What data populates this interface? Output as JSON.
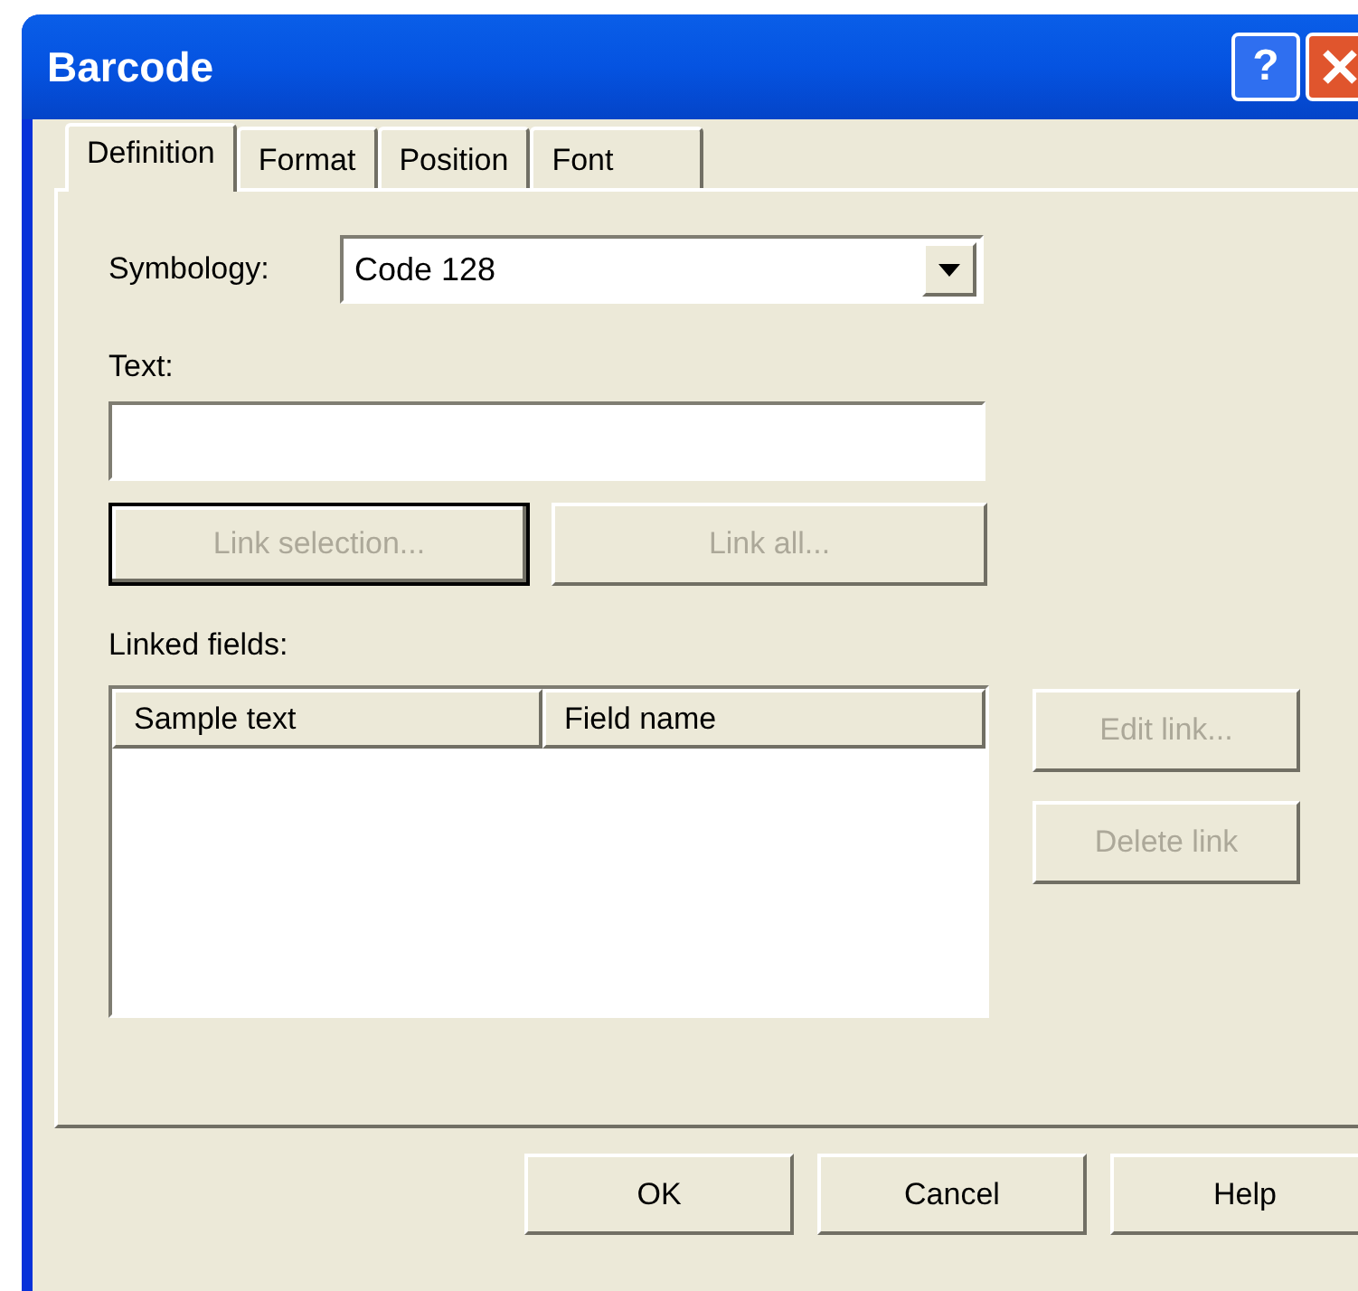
{
  "window": {
    "title": "Barcode"
  },
  "title_buttons": [
    {
      "kind": "help",
      "label": "?"
    },
    {
      "kind": "close"
    }
  ],
  "tabs": [
    {
      "label": "Definition",
      "selected": true
    },
    {
      "label": "Format",
      "selected": false
    },
    {
      "label": "Position",
      "selected": false
    },
    {
      "label": "Font",
      "selected": false
    }
  ],
  "symbology": {
    "label": "Symbology:",
    "value": "Code 128"
  },
  "text_field": {
    "label": "Text:"
  },
  "link_buttons": [
    {
      "label": "Link selection...",
      "disabled": true,
      "default": true
    },
    {
      "label": "Link all...",
      "disabled": true,
      "default": false
    }
  ],
  "linked_fields": {
    "label": "Linked fields:",
    "columns": [
      "Sample text",
      "Field name"
    ]
  },
  "side_buttons": [
    {
      "label": "Edit link...",
      "disabled": true
    },
    {
      "label": "Delete link",
      "disabled": true
    }
  ],
  "footer_buttons": [
    {
      "label": "OK",
      "disabled": false
    },
    {
      "label": "Cancel",
      "disabled": false
    },
    {
      "label": "Help",
      "disabled": false
    }
  ]
}
